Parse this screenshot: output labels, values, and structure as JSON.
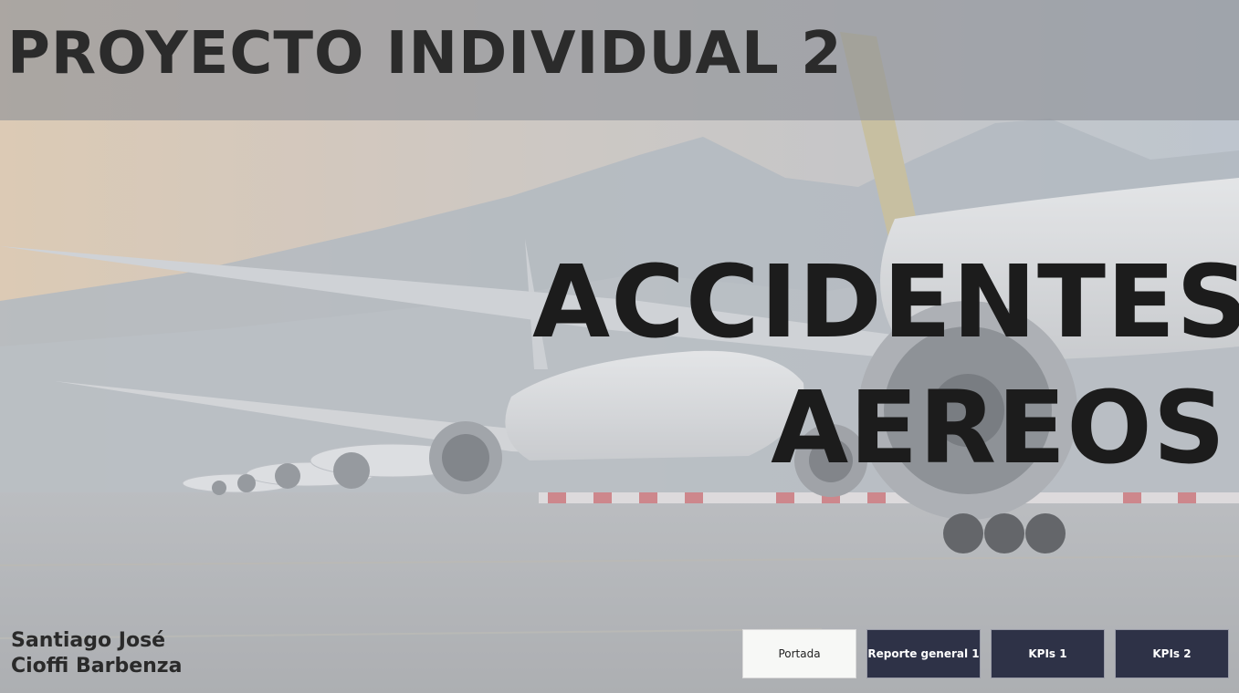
{
  "header": {
    "title": "PROYECTO INDIVIDUAL 2"
  },
  "hero": {
    "title_line1": "ACCIDENTES",
    "title_line2": "AEREOS"
  },
  "author": {
    "line1": "Santiago José",
    "line2": "Cioffi Barbenza"
  },
  "nav": {
    "buttons": [
      {
        "label": "Portada",
        "active": true
      },
      {
        "label": "Reporte general 1",
        "active": false
      },
      {
        "label": "KPIs 1",
        "active": false
      },
      {
        "label": "KPIs 2",
        "active": false
      }
    ]
  },
  "colors": {
    "nav_inactive_bg": "#2e3247",
    "nav_active_bg": "#f7f8f6",
    "title_text": "#1c1c1c"
  }
}
